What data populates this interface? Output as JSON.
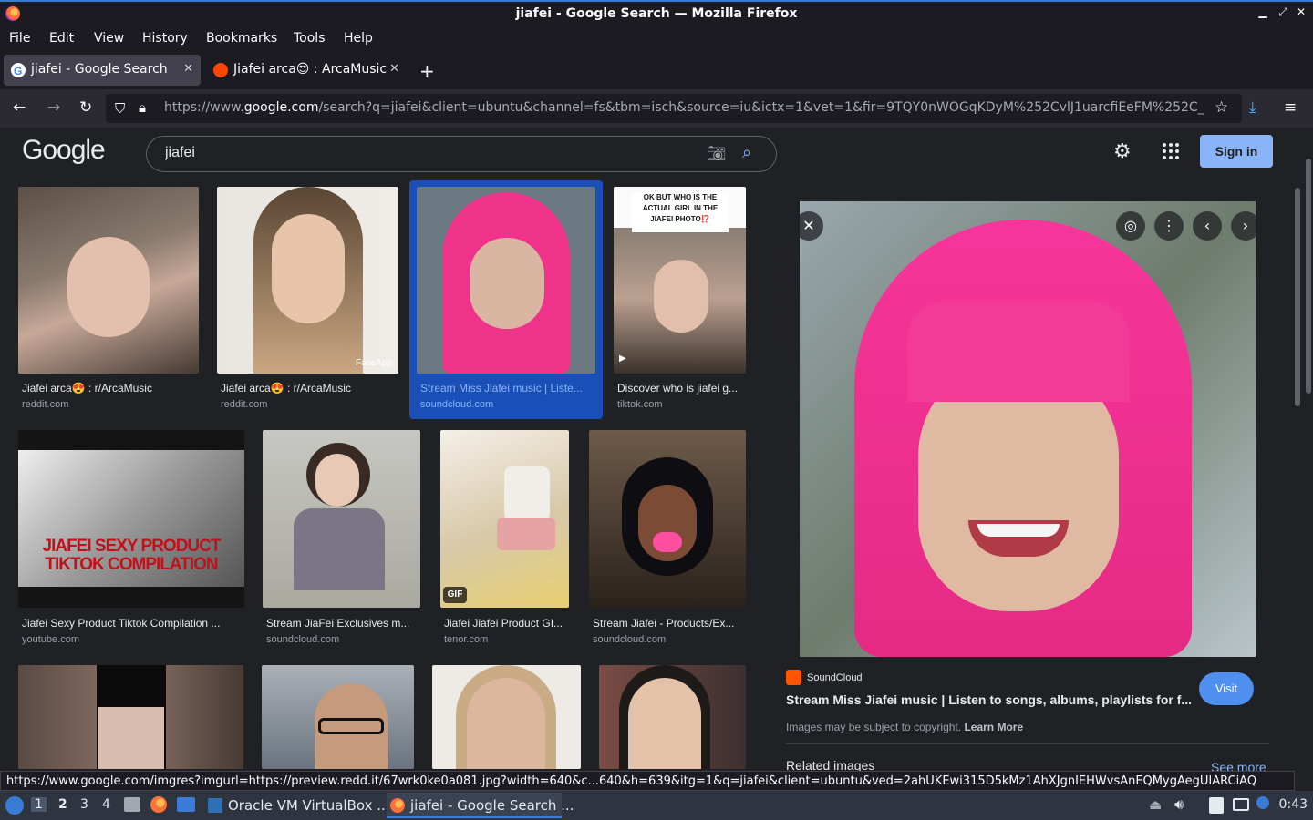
{
  "window": {
    "title": "jiafei - Google Search — Mozilla Firefox"
  },
  "menu": [
    "File",
    "Edit",
    "View",
    "History",
    "Bookmarks",
    "Tools",
    "Help"
  ],
  "tabs": [
    {
      "label": "jiafei - Google Search",
      "active": true
    },
    {
      "label": "Jiafei arca😍 : ArcaMusic",
      "active": false
    }
  ],
  "url": {
    "host_prefix": "https://www.",
    "host": "google.com",
    "path": "/search?q=jiafei&client=ubuntu&channel=fs&tbm=isch&source=iu&ictx=1&vet=1&fir=9TQY0nWOGqKDyM%252CvlJ1uarcfiEeFM%252C_"
  },
  "google": {
    "logo": "Google",
    "query": "jiafei",
    "signin": "Sign in"
  },
  "results": [
    {
      "caption": "Jiafei arca😍 : r/ArcaMusic",
      "source": "reddit.com"
    },
    {
      "caption": "Jiafei arca😍 : r/ArcaMusic",
      "source": "reddit.com",
      "overlay": "FaceApp"
    },
    {
      "caption": "Stream Miss Jiafei music | Liste...",
      "source": "soundcloud.com"
    },
    {
      "caption": "Discover who is jiafei g...",
      "source": "tiktok.com",
      "overlay": "OK BUT WHO IS THE ACTUAL GIRL IN THE JIAFEI PHOTO⁉️"
    },
    {
      "caption": "Jiafei Sexy Product Tiktok Compilation ...",
      "source": "youtube.com",
      "overlay": "JIAFEI SEXY PRODUCT TIKTOK COMPILATION"
    },
    {
      "caption": "Stream JiaFei Exclusives m...",
      "source": "soundcloud.com"
    },
    {
      "caption": "Jiafei Jiafei Product GI...",
      "source": "tenor.com",
      "overlay": "GIF"
    },
    {
      "caption": "Stream Jiafei - Products/Ex...",
      "source": "soundcloud.com"
    }
  ],
  "preview": {
    "source": "SoundCloud",
    "title": "Stream Miss Jiafei music | Listen to songs, albums, playlists for f...",
    "copyright": "Images may be subject to copyright.",
    "learn_more": "Learn More",
    "visit": "Visit",
    "related": "Related images",
    "see_more": "See more"
  },
  "status_url": "https://www.google.com/imgres?imgurl=https://preview.redd.it/67wrk0ke0a081.jpg?width=640&c...640&h=639&itg=1&q=jiafei&client=ubuntu&ved=2ahUKEwi315D5kMz1AhXJgnIEHWvsAnEQMygAegUIARCiAQ",
  "taskbar": {
    "workspaces": [
      "1",
      "2",
      "3",
      "4"
    ],
    "tasks": [
      "Oracle VM VirtualBox ...",
      "jiafei - Google Search ..."
    ],
    "clock": "0:43"
  },
  "colors": {
    "accent": "#8ab4f8",
    "selected": "#1a4fb8",
    "pink": "#f0338a"
  }
}
